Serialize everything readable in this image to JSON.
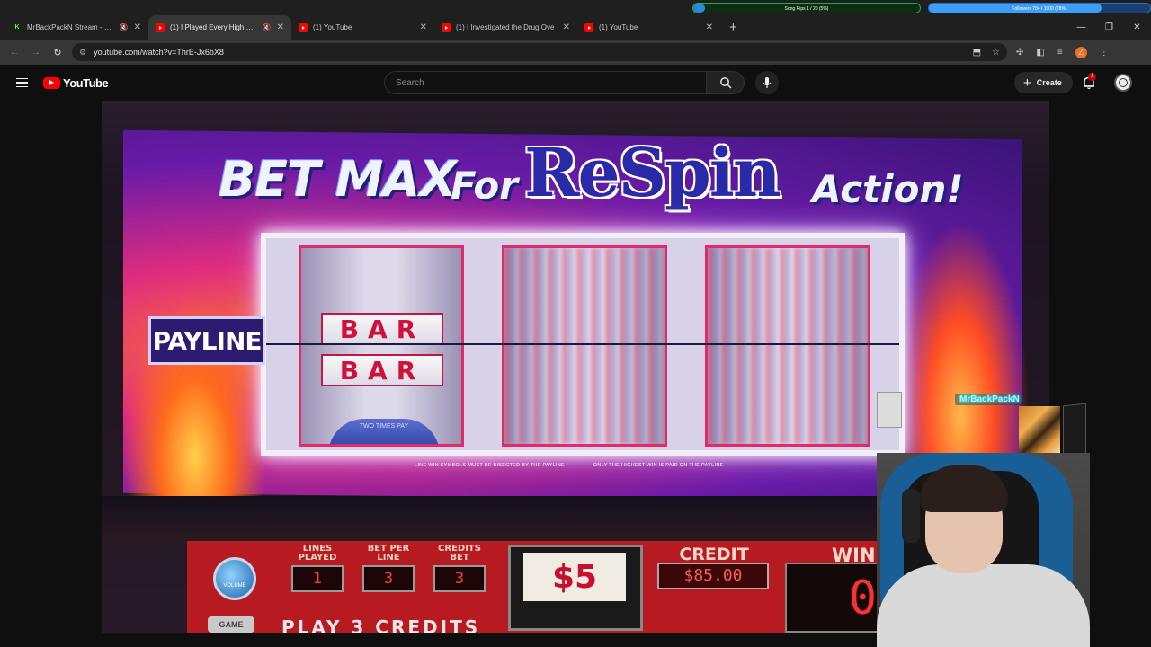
{
  "overlay": {
    "song_bar": {
      "label": "Song Rips 1 / 20 (5%)",
      "progress": 0.05,
      "color": "#23a845"
    },
    "followers_bar": {
      "label": "Followers 784 / 1000 (78%)",
      "progress": 0.78,
      "color": "#3d9ef7"
    }
  },
  "tabs": [
    {
      "icon": "kick-favicon",
      "title": "MrBackPackN Stream - Wa",
      "muted": true,
      "active": false
    },
    {
      "icon": "youtube-favicon",
      "title": "(1) I Played Every High Limi",
      "muted": true,
      "active": true
    },
    {
      "icon": "youtube-favicon",
      "title": "(1) YouTube",
      "muted": false,
      "active": false
    },
    {
      "icon": "youtube-favicon",
      "title": "(1) I Investigated the Drug Ove",
      "muted": false,
      "active": false
    },
    {
      "icon": "youtube-favicon",
      "title": "(1) YouTube",
      "muted": false,
      "active": false
    }
  ],
  "address_bar": {
    "url": "youtube.com/watch?v=ThrE-Jx6bX8"
  },
  "profile_badge": "Z",
  "youtube": {
    "logo_text": "YouTube",
    "search_placeholder": "Search",
    "create_label": "Create",
    "notification_count": "1"
  },
  "video": {
    "slot": {
      "headline_bet": "BET MAX",
      "headline_for": "For",
      "headline_respin": "ReSpin",
      "headline_action": "Action!",
      "reel_symbol_1": "BAR",
      "reel_symbol_2": "BAR",
      "times_pay": "TWO TIMES PAY",
      "payline_label": "PAYLINE",
      "fineprint_1": "LINE WIN SYMBOLS MUST BE BISECTED BY THE PAYLINE",
      "fineprint_2": "ONLY THE HIGHEST WIN IS PAID ON THE PAYLINE",
      "volume_label": "VOLUME",
      "lines_played_label": "LINES PLAYED",
      "lines_played_value": "1",
      "bet_per_line_label": "BET PER LINE",
      "bet_per_line_value": "3",
      "credits_bet_label": "CREDITS BET",
      "credits_bet_value": "3",
      "denomination": "$5",
      "credit_label": "CREDIT",
      "credit_value": "$85.00",
      "win_label": "WIN",
      "win_value": "0",
      "game_button": "GAME",
      "play_credits": "PLAY 3 CREDITS"
    },
    "chat_username": "MrBackPackN"
  }
}
